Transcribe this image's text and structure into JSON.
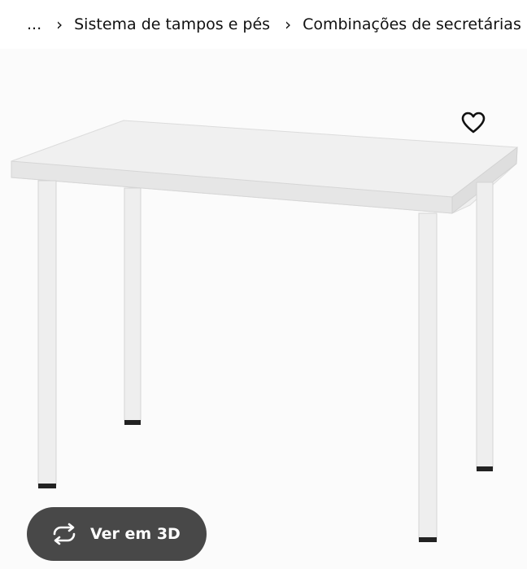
{
  "breadcrumb": {
    "ellipsis": "...",
    "separator": "›",
    "items": [
      {
        "label": "Sistema de tampos e pés"
      },
      {
        "label": "Combinações de secretárias"
      }
    ]
  },
  "favorite": {
    "icon": "heart-outline-icon"
  },
  "view_3d": {
    "label": "Ver em 3D",
    "icon": "rotate-arrows-icon"
  },
  "colors": {
    "button_bg": "#484848",
    "image_bg": "#fbfbfb"
  }
}
